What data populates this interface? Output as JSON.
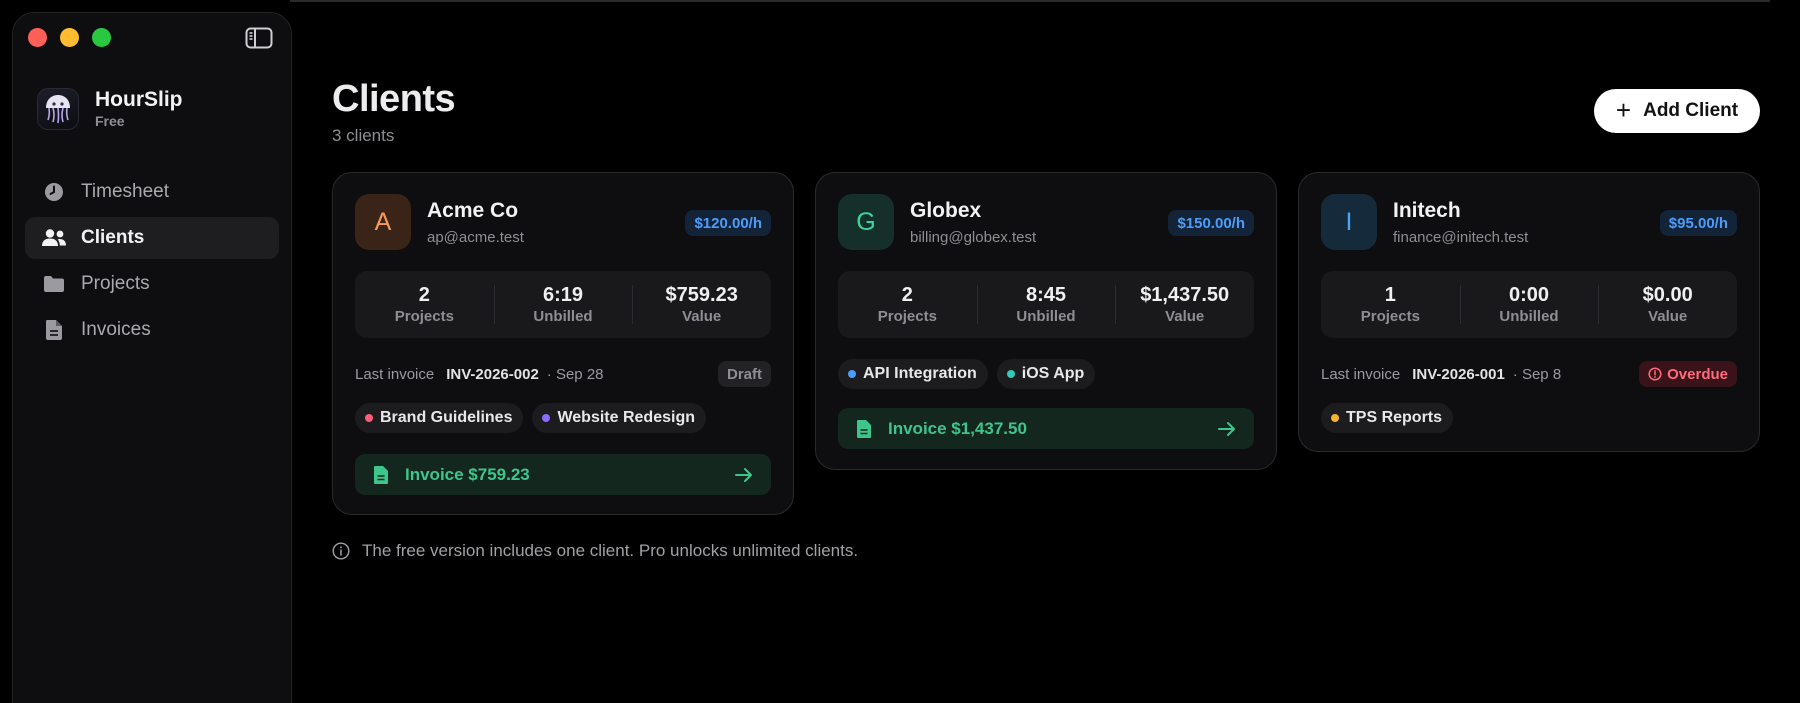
{
  "app": {
    "name": "HourSlip",
    "plan": "Free"
  },
  "nav": [
    {
      "label": "Timesheet",
      "icon": "clock-icon",
      "active": false
    },
    {
      "label": "Clients",
      "icon": "users-icon",
      "active": true
    },
    {
      "label": "Projects",
      "icon": "folder-icon",
      "active": false
    },
    {
      "label": "Invoices",
      "icon": "document-icon",
      "active": false
    }
  ],
  "header": {
    "title": "Clients",
    "subtitle": "3 clients",
    "add_button": "Add Client"
  },
  "labels": {
    "projects": "Projects",
    "unbilled": "Unbilled",
    "value": "Value",
    "last_invoice": "Last invoice"
  },
  "clients": [
    {
      "initial": "A",
      "name": "Acme Co",
      "email": "ap@acme.test",
      "rate": "$120.00/h",
      "avatar_bg": "#3a2418",
      "avatar_fg": "#f59a5b",
      "projects": "2",
      "unbilled": "6:19",
      "value": "$759.23",
      "last_invoice_number": "INV-2026-002",
      "last_invoice_date": "· Sep 28",
      "status": "Draft",
      "tags": [
        {
          "label": "Brand Guidelines",
          "color": "#ff5d7a"
        },
        {
          "label": "Website Redesign",
          "color": "#8c6cff"
        }
      ],
      "invoice_button": "Invoice $759.23"
    },
    {
      "initial": "G",
      "name": "Globex",
      "email": "billing@globex.test",
      "rate": "$150.00/h",
      "avatar_bg": "#15302a",
      "avatar_fg": "#3ed59a",
      "projects": "2",
      "unbilled": "8:45",
      "value": "$1,437.50",
      "tags": [
        {
          "label": "API Integration",
          "color": "#4c9dfb"
        },
        {
          "label": "iOS App",
          "color": "#33c9b8"
        }
      ],
      "invoice_button": "Invoice $1,437.50"
    },
    {
      "initial": "I",
      "name": "Initech",
      "email": "finance@initech.test",
      "rate": "$95.00/h",
      "avatar_bg": "#152a3a",
      "avatar_fg": "#47a6f5",
      "projects": "1",
      "unbilled": "0:00",
      "value": "$0.00",
      "last_invoice_number": "INV-2026-001",
      "last_invoice_date": "· Sep 8",
      "status": "Overdue",
      "tags": [
        {
          "label": "TPS Reports",
          "color": "#f5b42a"
        }
      ]
    }
  ],
  "footer_note": "The free version includes one client. Pro unlocks unlimited clients.",
  "colors": {
    "accent_green": "#3ec58b",
    "rate_blue": "#4c9dfb",
    "overdue_red": "#ff6b7c"
  }
}
